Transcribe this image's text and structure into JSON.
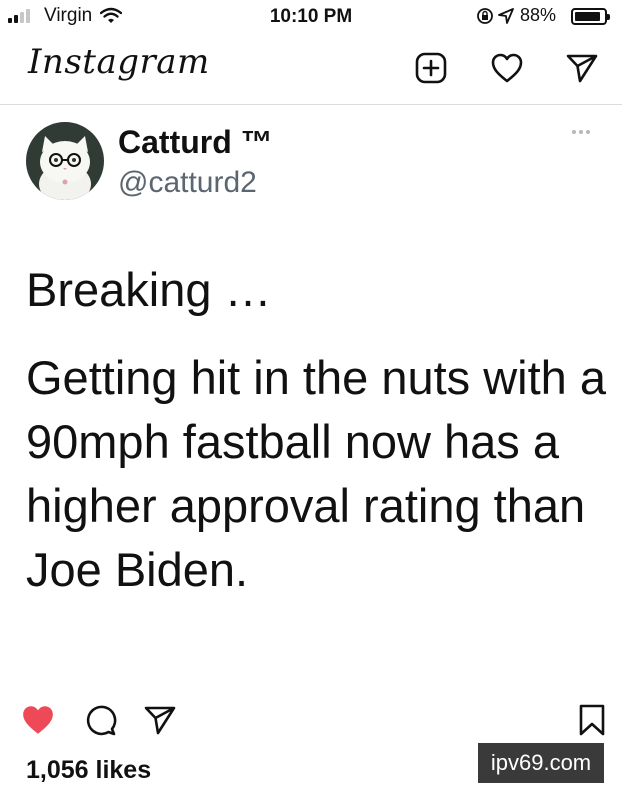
{
  "status_bar": {
    "carrier": "Virgin",
    "time": "10:10 PM",
    "battery_percent": "88%",
    "battery_level": 0.88,
    "signal_bars_active": 2,
    "signal_bars_total": 4
  },
  "header": {
    "app_name": "Instagram",
    "icons": [
      "plus-square-icon",
      "heart-icon",
      "send-icon"
    ]
  },
  "tweet": {
    "display_name": "Catturd ™",
    "handle": "@catturd2",
    "paragraphs": [
      "Breaking …",
      "Getting hit in the nuts with a 90mph fastball now has a higher approval rating than Joe Biden."
    ]
  },
  "actions": {
    "liked": true,
    "like_color": "#ed4956",
    "icons": [
      "heart-filled-icon",
      "comment-icon",
      "share-icon",
      "bookmark-icon"
    ]
  },
  "likes_text": "1,056 likes",
  "watermark": "ipv69.com"
}
